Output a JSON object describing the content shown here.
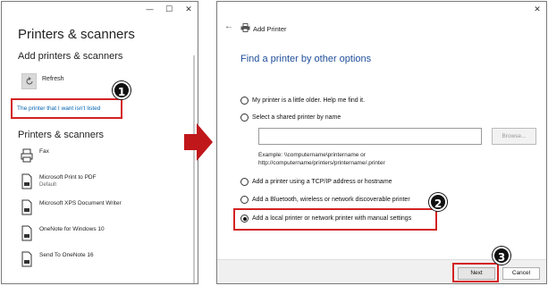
{
  "left_window": {
    "title": "Printers & scanners",
    "add_section": "Add printers & scanners",
    "refresh_label": "Refresh",
    "link_text": "The printer that I want isn't listed",
    "list_section": "Printers & scanners",
    "devices": [
      {
        "name": "Fax",
        "sub": "",
        "icon": "fax-icon"
      },
      {
        "name": "Microsoft Print to PDF",
        "sub": "Default",
        "icon": "printer-doc-icon"
      },
      {
        "name": "Microsoft XPS Document Writer",
        "sub": "",
        "icon": "printer-doc-icon"
      },
      {
        "name": "OneNote for Windows 10",
        "sub": "",
        "icon": "printer-doc-icon"
      },
      {
        "name": "Send To OneNote 16",
        "sub": "",
        "icon": "printer-doc-icon"
      }
    ],
    "window_controls": {
      "minimize": "—",
      "maximize": "☐",
      "close": "✕"
    }
  },
  "badges": {
    "one": "1",
    "two": "2",
    "three": "3"
  },
  "right_window": {
    "close": "✕",
    "back_glyph": "←",
    "title": "Add Printer",
    "heading": "Find a printer by other options",
    "options": [
      {
        "label": "My printer is a little older. Help me find it.",
        "selected": false
      },
      {
        "label": "Select a shared printer by name",
        "selected": false
      },
      {
        "label": "Add a printer using a TCP/IP address or hostname",
        "selected": false
      },
      {
        "label": "Add a Bluetooth, wireless or network discoverable printer",
        "selected": false
      },
      {
        "label": "Add a local printer or network printer with manual settings",
        "selected": true
      }
    ],
    "shared_input_value": "",
    "browse_label": "Browse...",
    "example_line1": "Example: \\\\computername\\printername or",
    "example_line2": "http://computername/printers/printername/.printer",
    "next_label": "Next",
    "cancel_label": "Cancel"
  },
  "colors": {
    "highlight": "#d32222",
    "link": "#0063b1",
    "heading": "#1f4e99",
    "arrow": "#c0171b"
  }
}
